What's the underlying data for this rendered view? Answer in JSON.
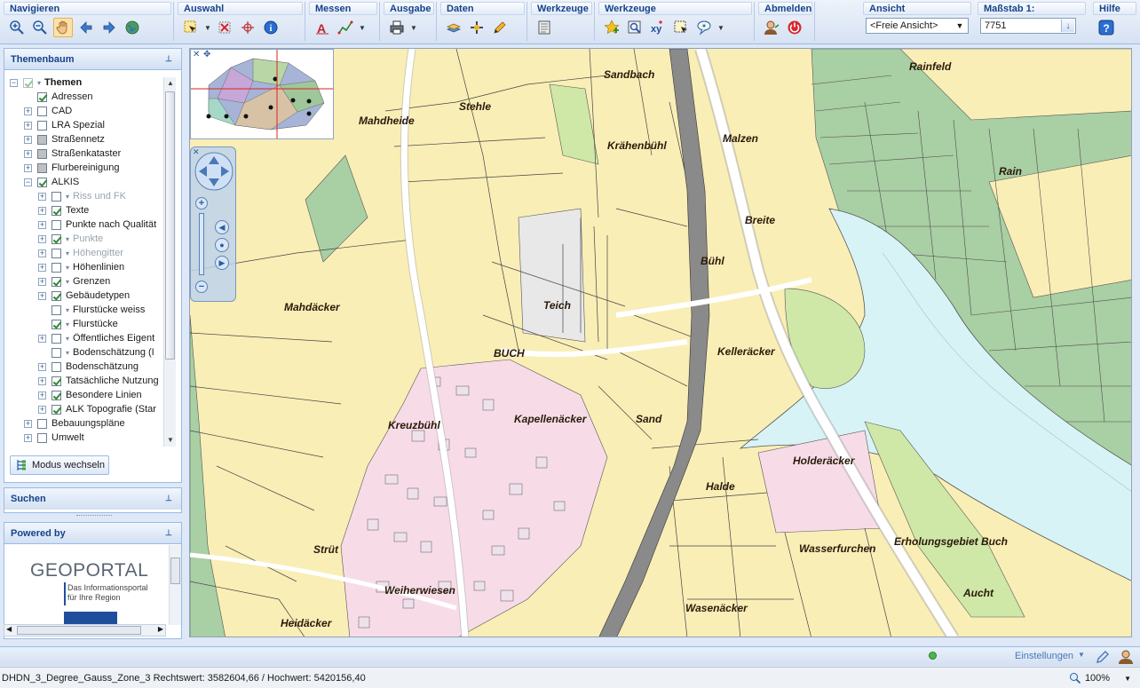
{
  "toolbar": {
    "groups": {
      "navigieren": "Navigieren",
      "auswahl": "Auswahl",
      "messen": "Messen",
      "ausgabe": "Ausgabe",
      "daten": "Daten",
      "werkzeuge1": "Werkzeuge",
      "werkzeuge2": "Werkzeuge",
      "abmelden": "Abmelden",
      "ansicht": "Ansicht",
      "massstab": "Maßstab 1:",
      "hilfe": "Hilfe"
    },
    "ansicht_value": "<Freie Ansicht>",
    "massstab_value": "7751"
  },
  "themenbaum": {
    "title": "Themenbaum",
    "items": [
      {
        "label": "Themen",
        "level": 0,
        "expander": "minus",
        "check": "checked-dim",
        "tri": true,
        "bold": true
      },
      {
        "label": "Adressen",
        "level": 1,
        "expander": "none",
        "check": "checked"
      },
      {
        "label": "CAD",
        "level": 1,
        "expander": "plus",
        "check": "empty"
      },
      {
        "label": "LRA Spezial",
        "level": 1,
        "expander": "plus",
        "check": "empty"
      },
      {
        "label": "Straßennetz",
        "level": 1,
        "expander": "plus",
        "check": "gray"
      },
      {
        "label": "Straßenkataster",
        "level": 1,
        "expander": "plus",
        "check": "gray"
      },
      {
        "label": "Flurbereinigung",
        "level": 1,
        "expander": "plus",
        "check": "gray"
      },
      {
        "label": "ALKIS",
        "level": 1,
        "expander": "minus",
        "check": "checked"
      },
      {
        "label": "Riss und FK",
        "level": 2,
        "expander": "plus",
        "check": "empty",
        "tri": true,
        "dim": true
      },
      {
        "label": "Texte",
        "level": 2,
        "expander": "plus",
        "check": "checked"
      },
      {
        "label": "Punkte nach Qualität",
        "level": 2,
        "expander": "plus",
        "check": "empty"
      },
      {
        "label": "Punkte",
        "level": 2,
        "expander": "plus",
        "check": "checked",
        "tri": true,
        "dim": true
      },
      {
        "label": "Höhengitter",
        "level": 2,
        "expander": "plus",
        "check": "empty",
        "tri": true,
        "dim": true
      },
      {
        "label": "Höhenlinien",
        "level": 2,
        "expander": "plus",
        "check": "empty",
        "tri": true
      },
      {
        "label": "Grenzen",
        "level": 2,
        "expander": "plus",
        "check": "checked",
        "tri": true
      },
      {
        "label": "Gebäudetypen",
        "level": 2,
        "expander": "plus",
        "check": "checked"
      },
      {
        "label": "Flurstücke weiss",
        "level": 2,
        "expander": "none",
        "check": "empty",
        "tri": true
      },
      {
        "label": "Flurstücke",
        "level": 2,
        "expander": "none",
        "check": "checked",
        "tri": true
      },
      {
        "label": "Öffentliches Eigent",
        "level": 2,
        "expander": "plus",
        "check": "empty",
        "tri": true
      },
      {
        "label": "Bodenschätzung (I",
        "level": 2,
        "expander": "none",
        "check": "empty",
        "tri": true
      },
      {
        "label": "Bodenschätzung",
        "level": 2,
        "expander": "plus",
        "check": "empty"
      },
      {
        "label": "Tatsächliche Nutzung",
        "level": 2,
        "expander": "plus",
        "check": "checked"
      },
      {
        "label": "Besondere Linien",
        "level": 2,
        "expander": "plus",
        "check": "checked"
      },
      {
        "label": "ALK Topografie (Star",
        "level": 2,
        "expander": "plus",
        "check": "checked"
      },
      {
        "label": "Bebauungspläne",
        "level": 1,
        "expander": "plus",
        "check": "empty"
      },
      {
        "label": "Umwelt",
        "level": 1,
        "expander": "plus",
        "check": "empty"
      }
    ],
    "modus_button": "Modus wechseln"
  },
  "suchen": {
    "title": "Suchen"
  },
  "powered": {
    "title": "Powered by",
    "logo_main": "GEOPORTAL",
    "logo_line1": "Das Informationsportal",
    "logo_line2": "für Ihre Region"
  },
  "map": {
    "labels": [
      "Sandbach",
      "Rainfeld",
      "Stehle",
      "Mahdheide",
      "Krähenbühl",
      "Malzen",
      "Rain",
      "Breite",
      "Bühl",
      "Teich",
      "Mahdäcker",
      "BUCH",
      "Kelleräcker",
      "Kapellenäcker",
      "Sand",
      "Kreuzbühl",
      "Holderäcker",
      "Halde",
      "Wasserfurchen",
      "Erholungsgebiet Buch",
      "Strüt",
      "Weiherwiesen",
      "Aucht",
      "Wasenäcker",
      "Heidäcker"
    ]
  },
  "bottombar": {
    "einstellungen": "Einstellungen"
  },
  "status": {
    "coords": "DHDN_3_Degree_Gauss_Zone_3 Rechtswert: 3582604,66 / Hochwert: 5420156,40",
    "zoom": "100%"
  },
  "colors": {
    "accent": "#15428b",
    "panel_border": "#99bbe8",
    "map_field": "#f9eeb6",
    "map_forest": "#a9cfa4",
    "map_water": "#d8f3f6",
    "map_settlement": "#f7dce8",
    "map_meadow": "#cfe8a8",
    "map_road": "#8a8a8a"
  }
}
